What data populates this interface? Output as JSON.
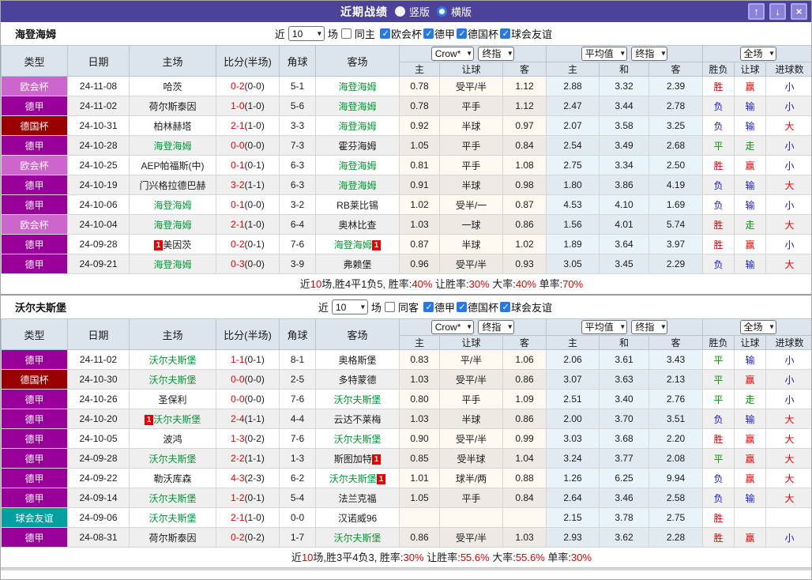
{
  "titlebar": {
    "title": "近期战绩",
    "radios": [
      {
        "label": "竖版",
        "selected": false
      },
      {
        "label": "横版",
        "selected": true
      }
    ],
    "buttons": {
      "up": "↑",
      "down": "↓",
      "close": "×"
    }
  },
  "league_colors": {
    "欧会杯": "#cc66cc",
    "德甲": "#990099",
    "德国杯": "#990000",
    "球会友谊": "#00a0a0"
  },
  "result_colors": {
    "胜": "red",
    "平": "green",
    "负": "blue",
    "赢": "red",
    "走": "green",
    "输": "blue",
    "大": "red",
    "小": "blue"
  },
  "columns": [
    "类型",
    "日期",
    "主场",
    "比分(半场)",
    "角球",
    "客场",
    "主",
    "让球",
    "客",
    "主",
    "和",
    "客",
    "胜负",
    "让球",
    "进球数"
  ],
  "sections": [
    {
      "team": "海登海姆",
      "filter": {
        "near": "近",
        "count": "10",
        "matches": "场",
        "same": "同主",
        "leagues": [
          "欧会杯",
          "德甲",
          "德国杯",
          "球会友谊"
        ]
      },
      "selects": {
        "company": "Crow*",
        "company_time": "终指",
        "avg": "平均值",
        "avg_time": "终指",
        "scope": "全场"
      },
      "rows": [
        {
          "lg": "欧会杯",
          "date": "24-11-08",
          "home": "哈茨",
          "hg": false,
          "hc": "",
          "ft": "0-2",
          "ht": "(0-0)",
          "cor": "5-1",
          "away": "海登海姆",
          "ag": true,
          "ac": "",
          "oh": "0.78",
          "hcap": "受平/半",
          "oa": "1.12",
          "ah": "2.88",
          "ad": "3.32",
          "aa": "2.39",
          "r1": "胜",
          "r2": "赢",
          "r3": "小"
        },
        {
          "lg": "德甲",
          "date": "24-11-02",
          "home": "荷尔斯泰因",
          "hg": false,
          "hc": "",
          "ft": "1-0",
          "ht": "(1-0)",
          "cor": "5-6",
          "away": "海登海姆",
          "ag": true,
          "ac": "",
          "oh": "0.78",
          "hcap": "平手",
          "oa": "1.12",
          "ah": "2.47",
          "ad": "3.44",
          "aa": "2.78",
          "r1": "负",
          "r2": "输",
          "r3": "小"
        },
        {
          "lg": "德国杯",
          "date": "24-10-31",
          "home": "柏林赫塔",
          "hg": false,
          "hc": "",
          "ft": "2-1",
          "ht": "(1-0)",
          "cor": "3-3",
          "away": "海登海姆",
          "ag": true,
          "ac": "",
          "oh": "0.92",
          "hcap": "半球",
          "oa": "0.97",
          "ah": "2.07",
          "ad": "3.58",
          "aa": "3.25",
          "r1": "负",
          "r2": "输",
          "r3": "大"
        },
        {
          "lg": "德甲",
          "date": "24-10-28",
          "home": "海登海姆",
          "hg": true,
          "hc": "",
          "ft": "0-0",
          "ht": "(0-0)",
          "cor": "7-3",
          "away": "霍芬海姆",
          "ag": false,
          "ac": "",
          "oh": "1.05",
          "hcap": "平手",
          "oa": "0.84",
          "ah": "2.54",
          "ad": "3.49",
          "aa": "2.68",
          "r1": "平",
          "r2": "走",
          "r3": "小"
        },
        {
          "lg": "欧会杯",
          "date": "24-10-25",
          "home": "AEP帕福斯(中)",
          "hg": false,
          "hc": "",
          "ft": "0-1",
          "ht": "(0-1)",
          "cor": "6-3",
          "away": "海登海姆",
          "ag": true,
          "ac": "",
          "oh": "0.81",
          "hcap": "平手",
          "oa": "1.08",
          "ah": "2.75",
          "ad": "3.34",
          "aa": "2.50",
          "r1": "胜",
          "r2": "赢",
          "r3": "小"
        },
        {
          "lg": "德甲",
          "date": "24-10-19",
          "home": "门兴格拉德巴赫",
          "hg": false,
          "hc": "",
          "ft": "3-2",
          "ht": "(1-1)",
          "cor": "6-3",
          "away": "海登海姆",
          "ag": true,
          "ac": "",
          "oh": "0.91",
          "hcap": "半球",
          "oa": "0.98",
          "ah": "1.80",
          "ad": "3.86",
          "aa": "4.19",
          "r1": "负",
          "r2": "输",
          "r3": "大"
        },
        {
          "lg": "德甲",
          "date": "24-10-06",
          "home": "海登海姆",
          "hg": true,
          "hc": "",
          "ft": "0-1",
          "ht": "(0-0)",
          "cor": "3-2",
          "away": "RB莱比锡",
          "ag": false,
          "ac": "",
          "oh": "1.02",
          "hcap": "受半/一",
          "oa": "0.87",
          "ah": "4.53",
          "ad": "4.10",
          "aa": "1.69",
          "r1": "负",
          "r2": "输",
          "r3": "小"
        },
        {
          "lg": "欧会杯",
          "date": "24-10-04",
          "home": "海登海姆",
          "hg": true,
          "hc": "",
          "ft": "2-1",
          "ht": "(1-0)",
          "cor": "6-4",
          "away": "奥林比查",
          "ag": false,
          "ac": "",
          "oh": "1.03",
          "hcap": "一球",
          "oa": "0.86",
          "ah": "1.56",
          "ad": "4.01",
          "aa": "5.74",
          "r1": "胜",
          "r2": "走",
          "r3": "大"
        },
        {
          "lg": "德甲",
          "date": "24-09-28",
          "home": "美因茨",
          "hg": false,
          "hc": "1",
          "ft": "0-2",
          "ht": "(0-1)",
          "cor": "7-6",
          "away": "海登海姆",
          "ag": true,
          "ac": "1",
          "oh": "0.87",
          "hcap": "半球",
          "oa": "1.02",
          "ah": "1.89",
          "ad": "3.64",
          "aa": "3.97",
          "r1": "胜",
          "r2": "赢",
          "r3": "小"
        },
        {
          "lg": "德甲",
          "date": "24-09-21",
          "home": "海登海姆",
          "hg": true,
          "hc": "",
          "ft": "0-3",
          "ht": "(0-0)",
          "cor": "3-9",
          "away": "弗赖堡",
          "ag": false,
          "ac": "",
          "oh": "0.96",
          "hcap": "受平/半",
          "oa": "0.93",
          "ah": "3.05",
          "ad": "3.45",
          "aa": "2.29",
          "r1": "负",
          "r2": "输",
          "r3": "大"
        }
      ],
      "summary": [
        {
          "t": "近",
          "c": "k"
        },
        {
          "t": "10",
          "c": "r"
        },
        {
          "t": "场,胜4平1负5, 胜率:",
          "c": "k"
        },
        {
          "t": "40%",
          "c": "r"
        },
        {
          "t": " 让胜率:",
          "c": "k"
        },
        {
          "t": "30%",
          "c": "r"
        },
        {
          "t": " 大率:",
          "c": "k"
        },
        {
          "t": "40%",
          "c": "r"
        },
        {
          "t": " 单率:",
          "c": "k"
        },
        {
          "t": "70%",
          "c": "r"
        }
      ]
    },
    {
      "team": "沃尔夫斯堡",
      "filter": {
        "near": "近",
        "count": "10",
        "matches": "场",
        "same": "同客",
        "leagues": [
          "德甲",
          "德国杯",
          "球会友谊"
        ]
      },
      "selects": {
        "company": "Crow*",
        "company_time": "终指",
        "avg": "平均值",
        "avg_time": "终指",
        "scope": "全场"
      },
      "rows": [
        {
          "lg": "德甲",
          "date": "24-11-02",
          "home": "沃尔夫斯堡",
          "hg": true,
          "hc": "",
          "ft": "1-1",
          "ht": "(0-1)",
          "cor": "8-1",
          "away": "奥格斯堡",
          "ag": false,
          "ac": "",
          "oh": "0.83",
          "hcap": "平/半",
          "oa": "1.06",
          "ah": "2.06",
          "ad": "3.61",
          "aa": "3.43",
          "r1": "平",
          "r2": "输",
          "r3": "小"
        },
        {
          "lg": "德国杯",
          "date": "24-10-30",
          "home": "沃尔夫斯堡",
          "hg": true,
          "hc": "",
          "ft": "0-0",
          "ht": "(0-0)",
          "cor": "2-5",
          "away": "多特蒙德",
          "ag": false,
          "ac": "",
          "oh": "1.03",
          "hcap": "受平/半",
          "oa": "0.86",
          "ah": "3.07",
          "ad": "3.63",
          "aa": "2.13",
          "r1": "平",
          "r2": "赢",
          "r3": "小"
        },
        {
          "lg": "德甲",
          "date": "24-10-26",
          "home": "圣保利",
          "hg": false,
          "hc": "",
          "ft": "0-0",
          "ht": "(0-0)",
          "cor": "7-6",
          "away": "沃尔夫斯堡",
          "ag": true,
          "ac": "",
          "oh": "0.80",
          "hcap": "平手",
          "oa": "1.09",
          "ah": "2.51",
          "ad": "3.40",
          "aa": "2.76",
          "r1": "平",
          "r2": "走",
          "r3": "小"
        },
        {
          "lg": "德甲",
          "date": "24-10-20",
          "home": "沃尔夫斯堡",
          "hg": true,
          "hc": "1",
          "ft": "2-4",
          "ht": "(1-1)",
          "cor": "4-4",
          "away": "云达不莱梅",
          "ag": false,
          "ac": "",
          "oh": "1.03",
          "hcap": "半球",
          "oa": "0.86",
          "ah": "2.00",
          "ad": "3.70",
          "aa": "3.51",
          "r1": "负",
          "r2": "输",
          "r3": "大"
        },
        {
          "lg": "德甲",
          "date": "24-10-05",
          "home": "波鸿",
          "hg": false,
          "hc": "",
          "ft": "1-3",
          "ht": "(0-2)",
          "cor": "7-6",
          "away": "沃尔夫斯堡",
          "ag": true,
          "ac": "",
          "oh": "0.90",
          "hcap": "受平/半",
          "oa": "0.99",
          "ah": "3.03",
          "ad": "3.68",
          "aa": "2.20",
          "r1": "胜",
          "r2": "赢",
          "r3": "大"
        },
        {
          "lg": "德甲",
          "date": "24-09-28",
          "home": "沃尔夫斯堡",
          "hg": true,
          "hc": "",
          "ft": "2-2",
          "ht": "(1-1)",
          "cor": "1-3",
          "away": "斯图加特",
          "ag": false,
          "ac": "1",
          "oh": "0.85",
          "hcap": "受半球",
          "oa": "1.04",
          "ah": "3.24",
          "ad": "3.77",
          "aa": "2.08",
          "r1": "平",
          "r2": "赢",
          "r3": "大"
        },
        {
          "lg": "德甲",
          "date": "24-09-22",
          "home": "勒沃库森",
          "hg": false,
          "hc": "",
          "ft": "4-3",
          "ht": "(2-3)",
          "cor": "6-2",
          "away": "沃尔夫斯堡",
          "ag": true,
          "ac": "1",
          "oh": "1.01",
          "hcap": "球半/两",
          "oa": "0.88",
          "ah": "1.26",
          "ad": "6.25",
          "aa": "9.94",
          "r1": "负",
          "r2": "赢",
          "r3": "大"
        },
        {
          "lg": "德甲",
          "date": "24-09-14",
          "home": "沃尔夫斯堡",
          "hg": true,
          "hc": "",
          "ft": "1-2",
          "ht": "(0-1)",
          "cor": "5-4",
          "away": "法兰克福",
          "ag": false,
          "ac": "",
          "oh": "1.05",
          "hcap": "平手",
          "oa": "0.84",
          "ah": "2.64",
          "ad": "3.46",
          "aa": "2.58",
          "r1": "负",
          "r2": "输",
          "r3": "大"
        },
        {
          "lg": "球会友谊",
          "date": "24-09-06",
          "home": "沃尔夫斯堡",
          "hg": true,
          "hc": "",
          "ft": "2-1",
          "ht": "(1-0)",
          "cor": "0-0",
          "away": "汉诺威96",
          "ag": false,
          "ac": "",
          "oh": "",
          "hcap": "",
          "oa": "",
          "ah": "2.15",
          "ad": "3.78",
          "aa": "2.75",
          "r1": "胜",
          "r2": "",
          "r3": ""
        },
        {
          "lg": "德甲",
          "date": "24-08-31",
          "home": "荷尔斯泰因",
          "hg": false,
          "hc": "",
          "ft": "0-2",
          "ht": "(0-2)",
          "cor": "1-7",
          "away": "沃尔夫斯堡",
          "ag": true,
          "ac": "",
          "oh": "0.86",
          "hcap": "受平/半",
          "oa": "1.03",
          "ah": "2.93",
          "ad": "3.62",
          "aa": "2.28",
          "r1": "胜",
          "r2": "赢",
          "r3": "小"
        }
      ],
      "summary": [
        {
          "t": "近",
          "c": "k"
        },
        {
          "t": "10",
          "c": "r"
        },
        {
          "t": "场,胜3平4负3, 胜率:",
          "c": "k"
        },
        {
          "t": "30%",
          "c": "r"
        },
        {
          "t": " 让胜率:",
          "c": "k"
        },
        {
          "t": "55.6%",
          "c": "r"
        },
        {
          "t": " 大率:",
          "c": "k"
        },
        {
          "t": "55.6%",
          "c": "r"
        },
        {
          "t": " 单率:",
          "c": "k"
        },
        {
          "t": "30%",
          "c": "r"
        }
      ]
    }
  ]
}
